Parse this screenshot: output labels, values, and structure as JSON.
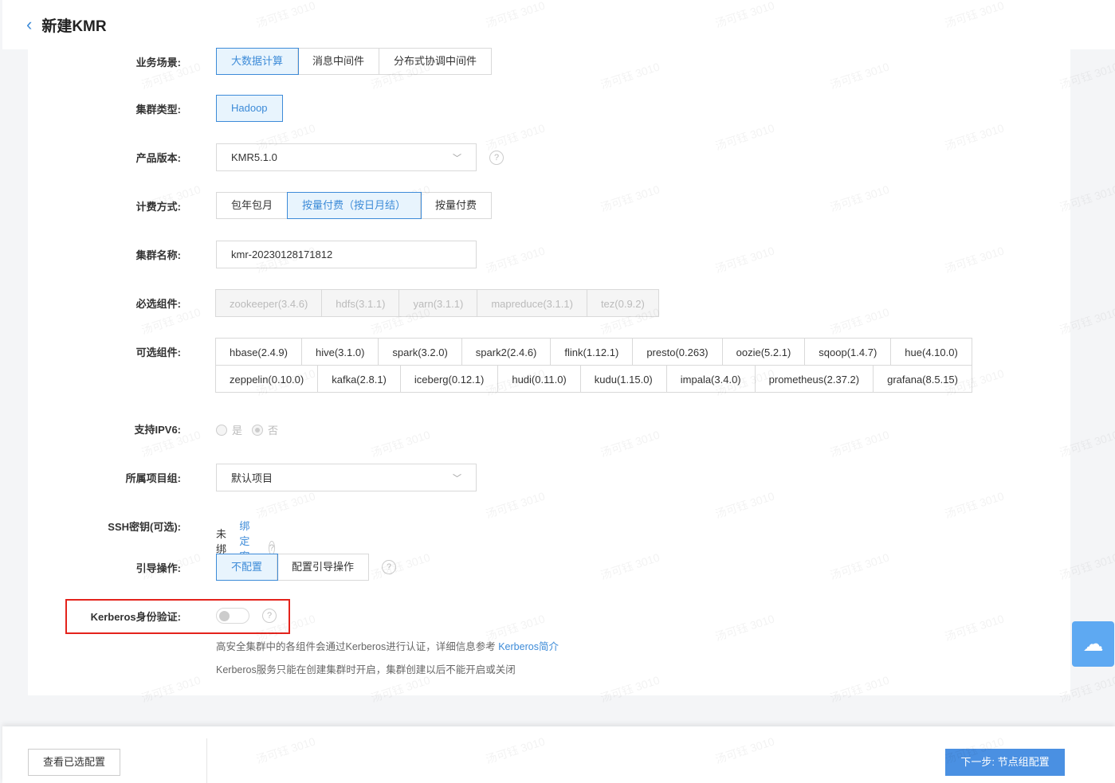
{
  "header": {
    "title": "新建KMR"
  },
  "form": {
    "scene": {
      "label": "业务场景:",
      "options": [
        "大数据计算",
        "消息中间件",
        "分布式协调中间件"
      ]
    },
    "cluster_type": {
      "label": "集群类型:",
      "value": "Hadoop"
    },
    "version": {
      "label": "产品版本:",
      "value": "KMR5.1.0"
    },
    "billing": {
      "label": "计费方式:",
      "options": [
        "包年包月",
        "按量付费（按日月结）",
        "按量付费"
      ]
    },
    "name": {
      "label": "集群名称:",
      "value": "kmr-20230128171812"
    },
    "required": {
      "label": "必选组件:",
      "items": [
        "zookeeper(3.4.6)",
        "hdfs(3.1.1)",
        "yarn(3.1.1)",
        "mapreduce(3.1.1)",
        "tez(0.9.2)"
      ]
    },
    "optional": {
      "label": "可选组件:",
      "row1": [
        "hbase(2.4.9)",
        "hive(3.1.0)",
        "spark(3.2.0)",
        "spark2(2.4.6)",
        "flink(1.12.1)",
        "presto(0.263)",
        "oozie(5.2.1)",
        "sqoop(1.4.7)",
        "hue(4.10.0)"
      ],
      "row2": [
        "zeppelin(0.10.0)",
        "kafka(2.8.1)",
        "iceberg(0.12.1)",
        "hudi(0.11.0)",
        "kudu(1.15.0)",
        "impala(3.4.0)",
        "prometheus(2.37.2)",
        "grafana(8.5.15)"
      ]
    },
    "ipv6": {
      "label": "支持IPV6:",
      "yes": "是",
      "no": "否"
    },
    "project": {
      "label": "所属项目组:",
      "value": "默认项目"
    },
    "ssh": {
      "label": "SSH密钥(可选):",
      "status": "未绑定",
      "link": "绑定密钥"
    },
    "bootstrap": {
      "label": "引导操作:",
      "options": [
        "不配置",
        "配置引导操作"
      ]
    },
    "kerberos": {
      "label": "Kerberos身份验证:",
      "enabled": false,
      "note1": "高安全集群中的各组件会通过Kerberos进行认证，详细信息参考",
      "note1_link": "Kerberos简介",
      "note2": "Kerberos服务只能在创建集群时开启，集群创建以后不能开启或关闭"
    }
  },
  "footer": {
    "view": "查看已选配置",
    "next": "下一步: 节点组配置"
  },
  "watermark": "汤可钰 3010"
}
